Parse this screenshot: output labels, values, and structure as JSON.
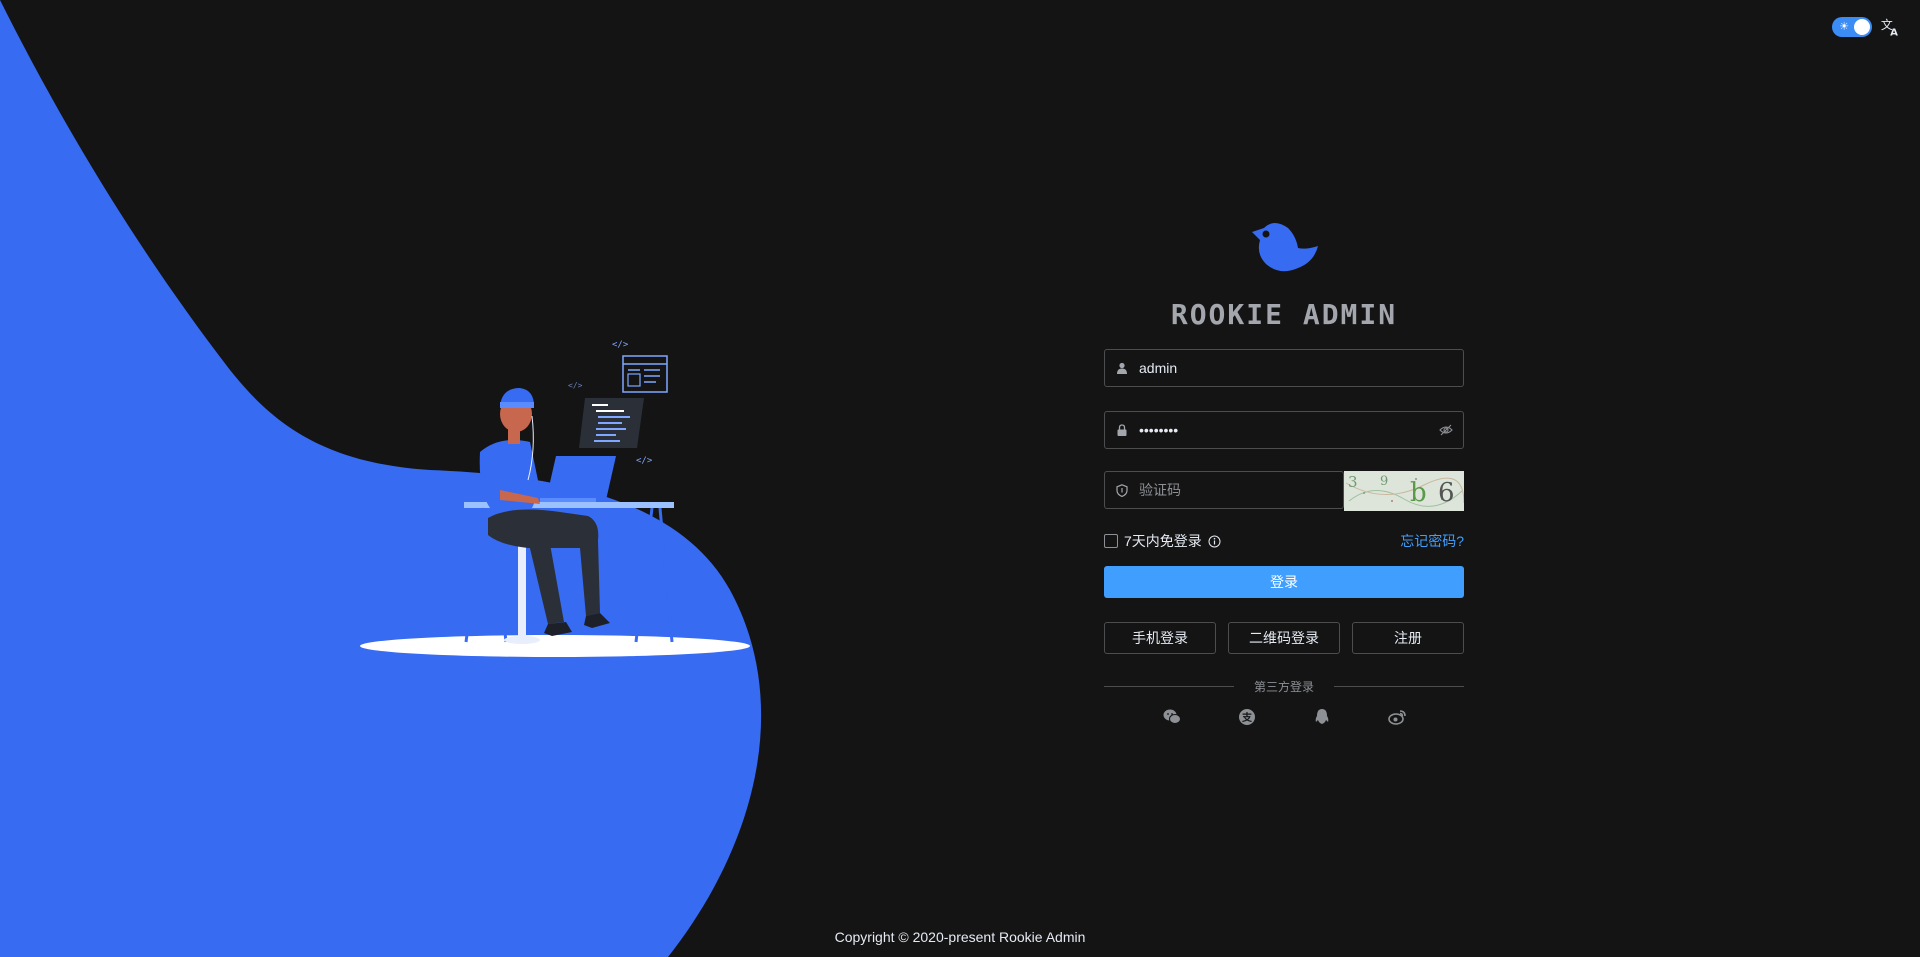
{
  "app": {
    "title": "ROOKIE ADMIN",
    "accent_color": "#409eff",
    "illustration_color": "#376bf2"
  },
  "header": {
    "theme_toggle_icon": "sun-icon",
    "lang_icon": "translate-icon"
  },
  "login": {
    "username_value": "admin",
    "password_value": "••••••••",
    "captcha_placeholder": "验证码",
    "captcha_text": "3 9 b 6",
    "remember_label": "7天内免登录",
    "forgot_label": "忘记密码?",
    "login_button": "登录",
    "alt_buttons": [
      "手机登录",
      "二维码登录",
      "注册"
    ],
    "third_party_label": "第三方登录",
    "social_icons": [
      "wechat-icon",
      "alipay-icon",
      "qq-icon",
      "weibo-icon"
    ]
  },
  "footer": {
    "copyright": "Copyright © 2020-present Rookie Admin"
  }
}
